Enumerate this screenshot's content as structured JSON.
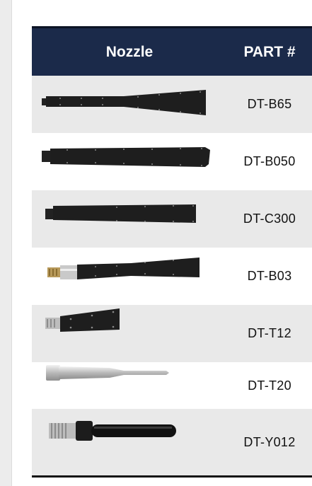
{
  "table": {
    "headers": {
      "nozzle": "Nozzle",
      "part": "PART #"
    },
    "rows": [
      {
        "part": "DT-B65",
        "nozzle_icon": "wide-blade-nozzle-icon"
      },
      {
        "part": "DT-B050",
        "nozzle_icon": "straight-blade-nozzle-icon"
      },
      {
        "part": "DT-C300",
        "nozzle_icon": "flat-rectangular-nozzle-icon"
      },
      {
        "part": "DT-B03",
        "nozzle_icon": "fitted-blade-nozzle-icon"
      },
      {
        "part": "DT-T12",
        "nozzle_icon": "short-blade-nozzle-icon"
      },
      {
        "part": "DT-T20",
        "nozzle_icon": "tapered-tube-nozzle-icon"
      },
      {
        "part": "DT-Y012",
        "nozzle_icon": "round-tube-nozzle-icon"
      }
    ]
  },
  "colors": {
    "header_bg": "#1b2a4a",
    "row_alt_bg": "#e9e9e9"
  }
}
